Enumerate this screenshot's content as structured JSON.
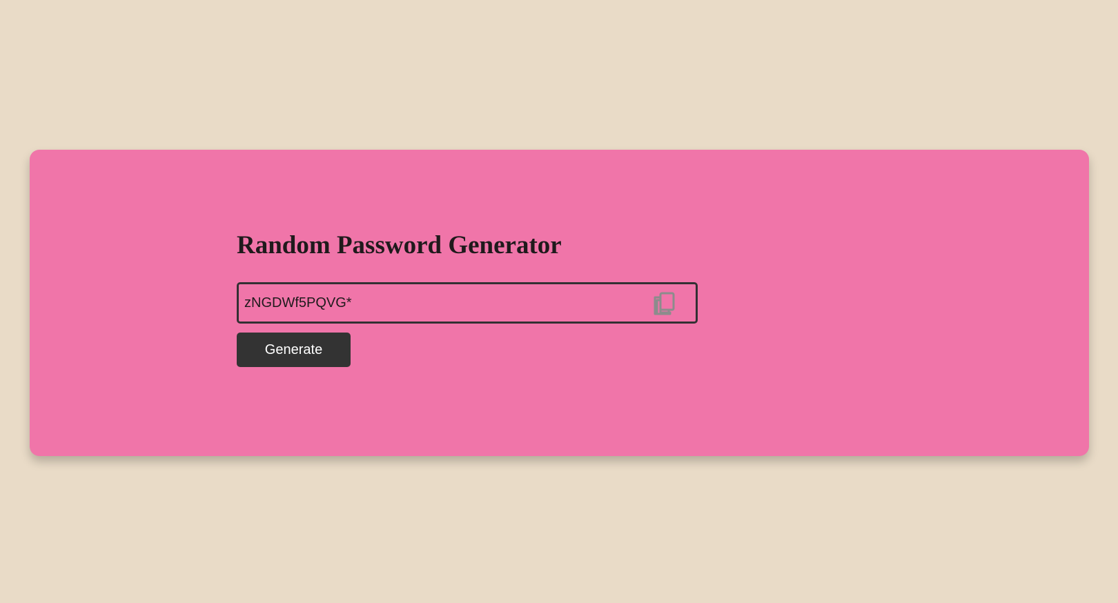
{
  "app": {
    "title": "Random Password Generator"
  },
  "password_field": {
    "value": "zNGDWf5PQVG*",
    "copy_icon": "copy-icon"
  },
  "actions": {
    "generate_label": "Generate"
  },
  "colors": {
    "page_background": "#e9dbc7",
    "card_background": "#f075a9",
    "button_background": "#333333",
    "border": "#333033"
  }
}
